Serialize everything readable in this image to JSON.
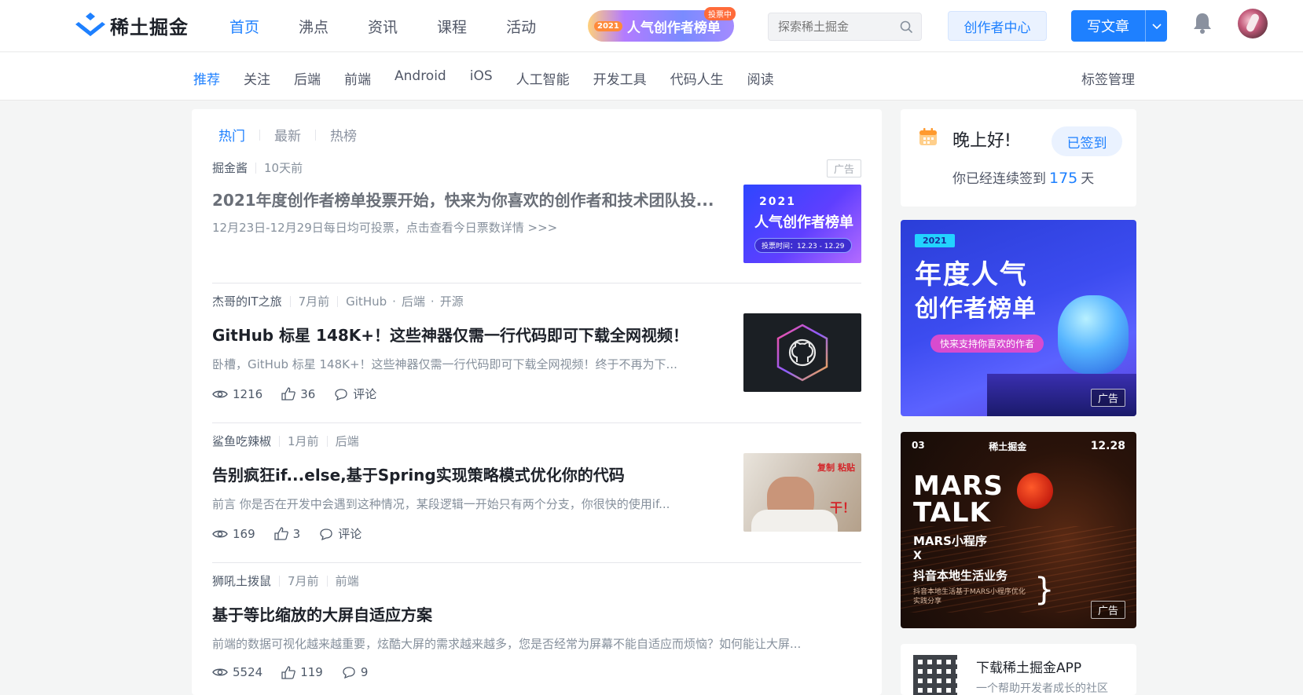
{
  "brand": {
    "name": "稀土掘金"
  },
  "main_nav": [
    "首页",
    "沸点",
    "资讯",
    "课程",
    "活动"
  ],
  "creator_banner": {
    "year": "2021",
    "text": "人气创作者榜单",
    "badge": "投票中"
  },
  "search": {
    "placeholder": "探索稀土掘金"
  },
  "header_buttons": {
    "creator_center": "创作者中心",
    "write": "写文章"
  },
  "sub_nav": {
    "tags": [
      "推荐",
      "关注",
      "后端",
      "前端",
      "Android",
      "iOS",
      "人工智能",
      "开发工具",
      "代码人生",
      "阅读"
    ],
    "manage": "标签管理"
  },
  "feed_tabs": [
    "热门",
    "最新",
    "热榜"
  ],
  "articles": [
    {
      "author": "掘金酱",
      "time": "10天前",
      "tags": [],
      "ad_label": "广告",
      "title": "2021年度创作者榜单投票开始，快来为你喜欢的创作者和技术团队投...",
      "abstract": "12月23日-12月29日每日均可投票，点击查看今日票数详情 >>>",
      "thumb": {
        "year": "2021",
        "title": "人气创作者榜单",
        "date": "投票时间：12.23 - 12.29"
      }
    },
    {
      "author": "杰哥的IT之旅",
      "time": "7月前",
      "tags": [
        "GitHub",
        "后端",
        "开源"
      ],
      "title": "GitHub 标星 148K+！这些神器仅需一行代码即可下载全网视频！",
      "abstract": "卧槽，GitHub 标星 148K+！这些神器仅需一行代码即可下载全网视频！终于不再为下...",
      "views": "1216",
      "likes": "36",
      "comments": "评论"
    },
    {
      "author": "鲨鱼吃辣椒",
      "time": "1月前",
      "tags": [
        "后端"
      ],
      "title": "告别疯狂if...else,基于Spring实现策略模式优化你的代码",
      "abstract": "前言 你是否在开发中会遇到这种情况，某段逻辑一开始只有两个分支，你很快的使用if...",
      "views": "169",
      "likes": "3",
      "comments": "评论",
      "thumb": {
        "red_top": "复制 粘贴",
        "red_bottom": "干！"
      }
    },
    {
      "author": "狮吼土拨鼠",
      "time": "7月前",
      "tags": [
        "前端"
      ],
      "title": "基于等比缩放的大屏自适应方案",
      "abstract": "前端的数据可视化越来越重要，炫酷大屏的需求越来越多，您是否经常为屏幕不能自适应而烦恼？如何能让大屏...",
      "views": "5524",
      "likes": "119",
      "comments": "9"
    }
  ],
  "signin": {
    "greeting": "晚上好!",
    "button": "已签到",
    "streak_prefix": "你已经连续签到",
    "streak_days": "175",
    "streak_suffix": "天"
  },
  "promo_1": {
    "tag": "2021",
    "line1": "年度人气",
    "line2": "创作者榜单",
    "pill": "快来支持你喜欢的作者",
    "ad": "广告"
  },
  "promo_2": {
    "num": "03",
    "brand": "稀土掘金",
    "date": "12.28",
    "mars": "MARS",
    "talk": "TALK",
    "l1": "MARS小程序",
    "l2": "X",
    "l3": "抖音本地生活业务",
    "small": "抖音本地生活基于MARS小程序优化实践分享",
    "ad": "广告"
  },
  "app_card": {
    "title": "下载稀土掘金APP",
    "subtitle": "一个帮助开发者成长的社区"
  },
  "colors": {
    "accent": "#1e80ff",
    "text": "#1d2129",
    "muted": "#86909c"
  }
}
